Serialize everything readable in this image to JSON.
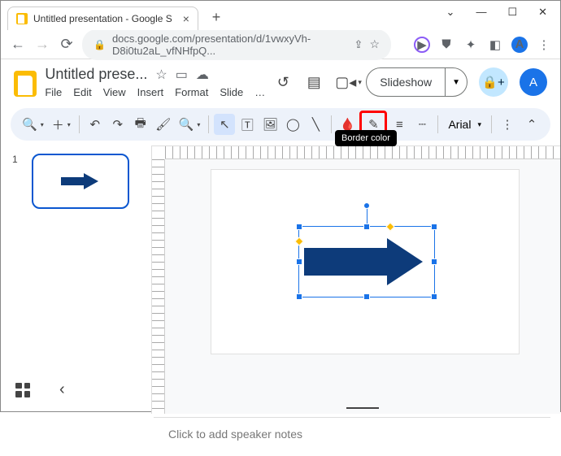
{
  "browser": {
    "tab_title": "Untitled presentation - Google S",
    "url": "docs.google.com/presentation/d/1vwxyVh-D8i0tu2aL_vfNHfpQ...",
    "avatar_letter": "A"
  },
  "header": {
    "doc_title": "Untitled prese...",
    "menu": [
      "File",
      "Edit",
      "View",
      "Insert",
      "Format",
      "Slide",
      "…"
    ],
    "slideshow_label": "Slideshow",
    "avatar_letter": "A"
  },
  "toolbar": {
    "font": "Arial",
    "tooltip": "Border color"
  },
  "sidepanel": {
    "slide_number": "1"
  },
  "notes": {
    "placeholder": "Click to add speaker notes"
  }
}
